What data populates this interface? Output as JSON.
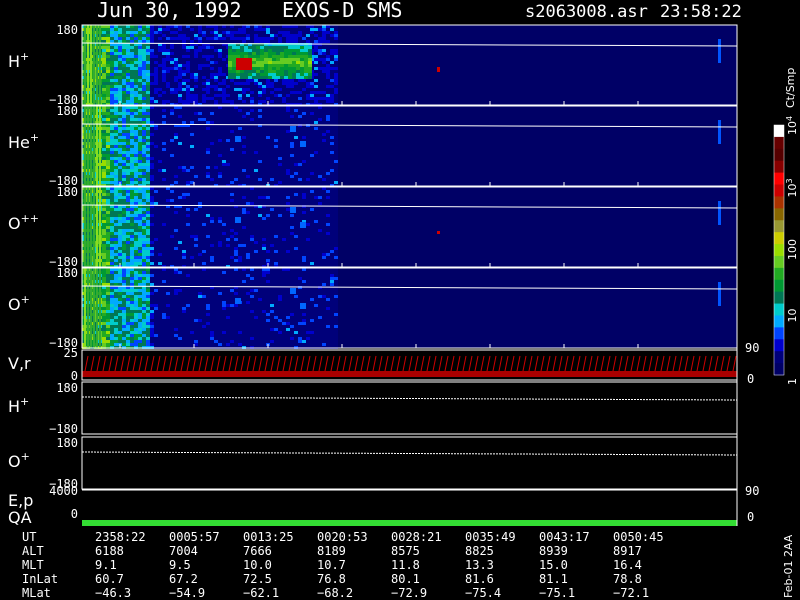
{
  "header": {
    "date": "Jun 30, 1992",
    "instrument": "EXOS-D SMS",
    "file": "s2063008.asr",
    "time": "23:58:22"
  },
  "colorbar": {
    "unit": "Ct/Smp",
    "ticks": [
      {
        "label": "10",
        "sup": "4",
        "level": 1.0
      },
      {
        "label": "10",
        "sup": "3",
        "level": 0.75
      },
      {
        "label": "100",
        "sup": "",
        "level": 0.5
      },
      {
        "label": "10",
        "sup": "",
        "level": 0.25
      },
      {
        "label": "1",
        "sup": "",
        "level": 0.0
      }
    ],
    "colors": [
      "#000066",
      "#00007a",
      "#0000cc",
      "#0044ff",
      "#00aaff",
      "#00cccc",
      "#007755",
      "#009933",
      "#22aa22",
      "#66cc22",
      "#99dd00",
      "#cccc00",
      "#999933",
      "#886600",
      "#aa3300",
      "#cc0000",
      "#ff0000",
      "#880000",
      "#550000",
      "#660000",
      "#ffffff"
    ]
  },
  "chart_data": {
    "type": "heatmap",
    "panels": [
      {
        "id": "h-plus",
        "label": "H",
        "sup": "+",
        "ytop": "180",
        "ybottom": "−180",
        "activity": {
          "h_plus_peak_time": "00:13:25",
          "baseline_level": "~1 Ct/Smp"
        }
      },
      {
        "id": "he-plus",
        "label": "He",
        "sup": "+",
        "ytop": "180",
        "ybottom": "−180"
      },
      {
        "id": "o-plus-plus",
        "label": "O",
        "sup": "++",
        "ytop": "180",
        "ybottom": "−180"
      },
      {
        "id": "o-plus",
        "label": "O",
        "sup": "+",
        "ytop": "180",
        "ybottom": "−180"
      }
    ],
    "vr_panel": {
      "label": "V,r",
      "ytop": "25",
      "ymid": "0",
      "right_top": "90",
      "right_bottom": "0"
    },
    "pitch_panels": [
      {
        "id": "h-plus-pitch",
        "label": "H",
        "sup": "+",
        "ytop": "180",
        "ybottom": "−180"
      },
      {
        "id": "o-plus-pitch",
        "label": "O",
        "sup": "+",
        "ytop": "180",
        "ybottom": "−180"
      }
    ],
    "ep_panel": {
      "label": "E,p",
      "ytop": "4000",
      "right_top": "90"
    },
    "qa_panel": {
      "label": "QA",
      "ytick": "0",
      "right_tick": "0"
    },
    "ephemeris": {
      "rows": [
        {
          "name": "UT",
          "values": [
            "2358:22",
            "0005:57",
            "0013:25",
            "0020:53",
            "0028:21",
            "0035:49",
            "0043:17",
            "0050:45"
          ]
        },
        {
          "name": "ALT",
          "values": [
            "6188",
            "7004",
            "7666",
            "8189",
            "8575",
            "8825",
            "8939",
            "8917"
          ]
        },
        {
          "name": "MLT",
          "values": [
            "9.1",
            "9.5",
            "10.0",
            "10.7",
            "11.8",
            "13.3",
            "15.0",
            "16.4"
          ]
        },
        {
          "name": "InLat",
          "values": [
            "60.7",
            "67.2",
            "72.5",
            "76.8",
            "80.1",
            "81.6",
            "81.1",
            "78.8"
          ]
        },
        {
          "name": "MLat",
          "values": [
            "−46.3",
            "−54.9",
            "−62.1",
            "−68.2",
            "−72.9",
            "−75.4",
            "−75.1",
            "−72.1"
          ]
        }
      ]
    }
  },
  "footer": {
    "generated": "Feb-01 2AA"
  }
}
